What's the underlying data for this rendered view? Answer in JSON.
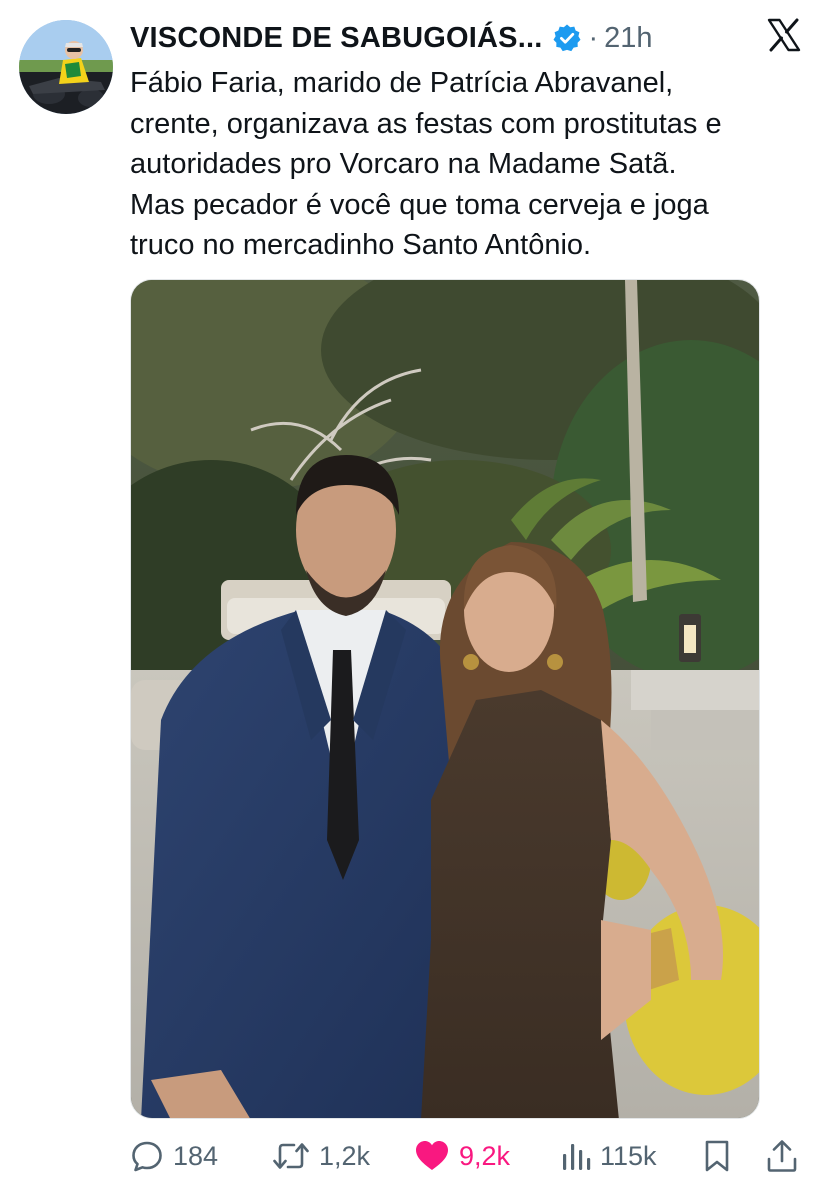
{
  "post": {
    "author": {
      "display_name": "VISCONDE DE SABUGOIÁS...",
      "verified": true
    },
    "separator": "·",
    "time_ago": "21h",
    "text_lines": [
      "Fábio Faria, marido de Patrícia Abravanel,",
      "crente, organizava as festas com prostitutas e",
      "autoridades pro Vorcaro na Madame Satã.",
      "Mas pecador é você que toma cerveja e joga",
      "truco no mercadinho Santo Antônio."
    ],
    "media": {
      "type": "photo",
      "content": "couple-portrait-garden"
    }
  },
  "actions": {
    "replies": {
      "icon": "reply-icon",
      "count": "184"
    },
    "reposts": {
      "icon": "repost-icon",
      "count": "1,2k"
    },
    "likes": {
      "icon": "heart-icon",
      "count": "9,2k",
      "liked": true
    },
    "views": {
      "icon": "views-icon",
      "count": "115k"
    },
    "bookmark": {
      "icon": "bookmark-icon"
    },
    "share": {
      "icon": "share-icon"
    }
  },
  "colors": {
    "text": "#0f1419",
    "secondary": "#536471",
    "verified": "#1d9bf0",
    "like": "#f91880"
  }
}
